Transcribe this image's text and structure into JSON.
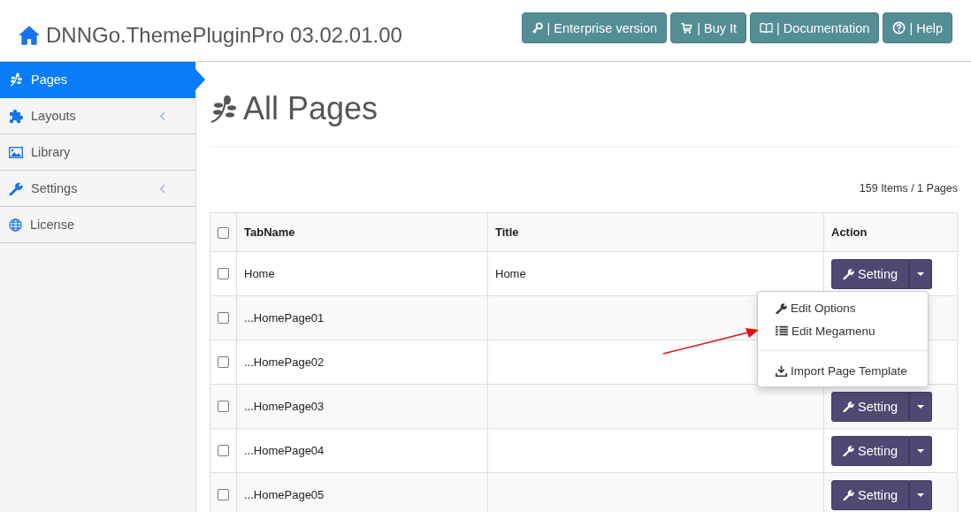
{
  "header": {
    "title": "DNNGo.ThemePluginPro 03.02.01.00",
    "buttons": [
      {
        "kind": "key",
        "label": "| Enterprise version"
      },
      {
        "kind": "cart",
        "label": "| Buy It"
      },
      {
        "kind": "book",
        "label": "| Documentation"
      },
      {
        "kind": "help",
        "label": "| Help"
      }
    ]
  },
  "sidebar": {
    "items": [
      {
        "label": "Pages",
        "selected": true,
        "has_submenu": false
      },
      {
        "label": "Layouts",
        "selected": false,
        "has_submenu": true
      },
      {
        "label": "Library",
        "selected": false,
        "has_submenu": false
      },
      {
        "label": "Settings",
        "selected": false,
        "has_submenu": true
      },
      {
        "label": "License",
        "selected": false,
        "has_submenu": false
      }
    ]
  },
  "page": {
    "title": "All Pages",
    "count": "159 Items / 1 Pages"
  },
  "table": {
    "header_checked": false,
    "columns": [
      "TabName",
      "Title",
      "Action"
    ],
    "rows": [
      {
        "checked": false,
        "tabname": "Home",
        "title": "Home",
        "action": "Setting"
      },
      {
        "checked": false,
        "tabname": "...HomePage01"
      },
      {
        "checked": false,
        "tabname": "...HomePage02"
      },
      {
        "checked": false,
        "tabname": "...HomePage03",
        "action": "Setting"
      },
      {
        "checked": false,
        "tabname": "...HomePage04",
        "action": "Setting"
      },
      {
        "checked": false,
        "tabname": "...HomePage05",
        "action": "Setting"
      }
    ]
  },
  "dropdown": {
    "items": [
      {
        "label": "Edit Options",
        "divider_before": false
      },
      {
        "label": "Edit Megamenu",
        "divider_before": false
      },
      {
        "label": "Import Page Template",
        "divider_before": true
      }
    ]
  }
}
